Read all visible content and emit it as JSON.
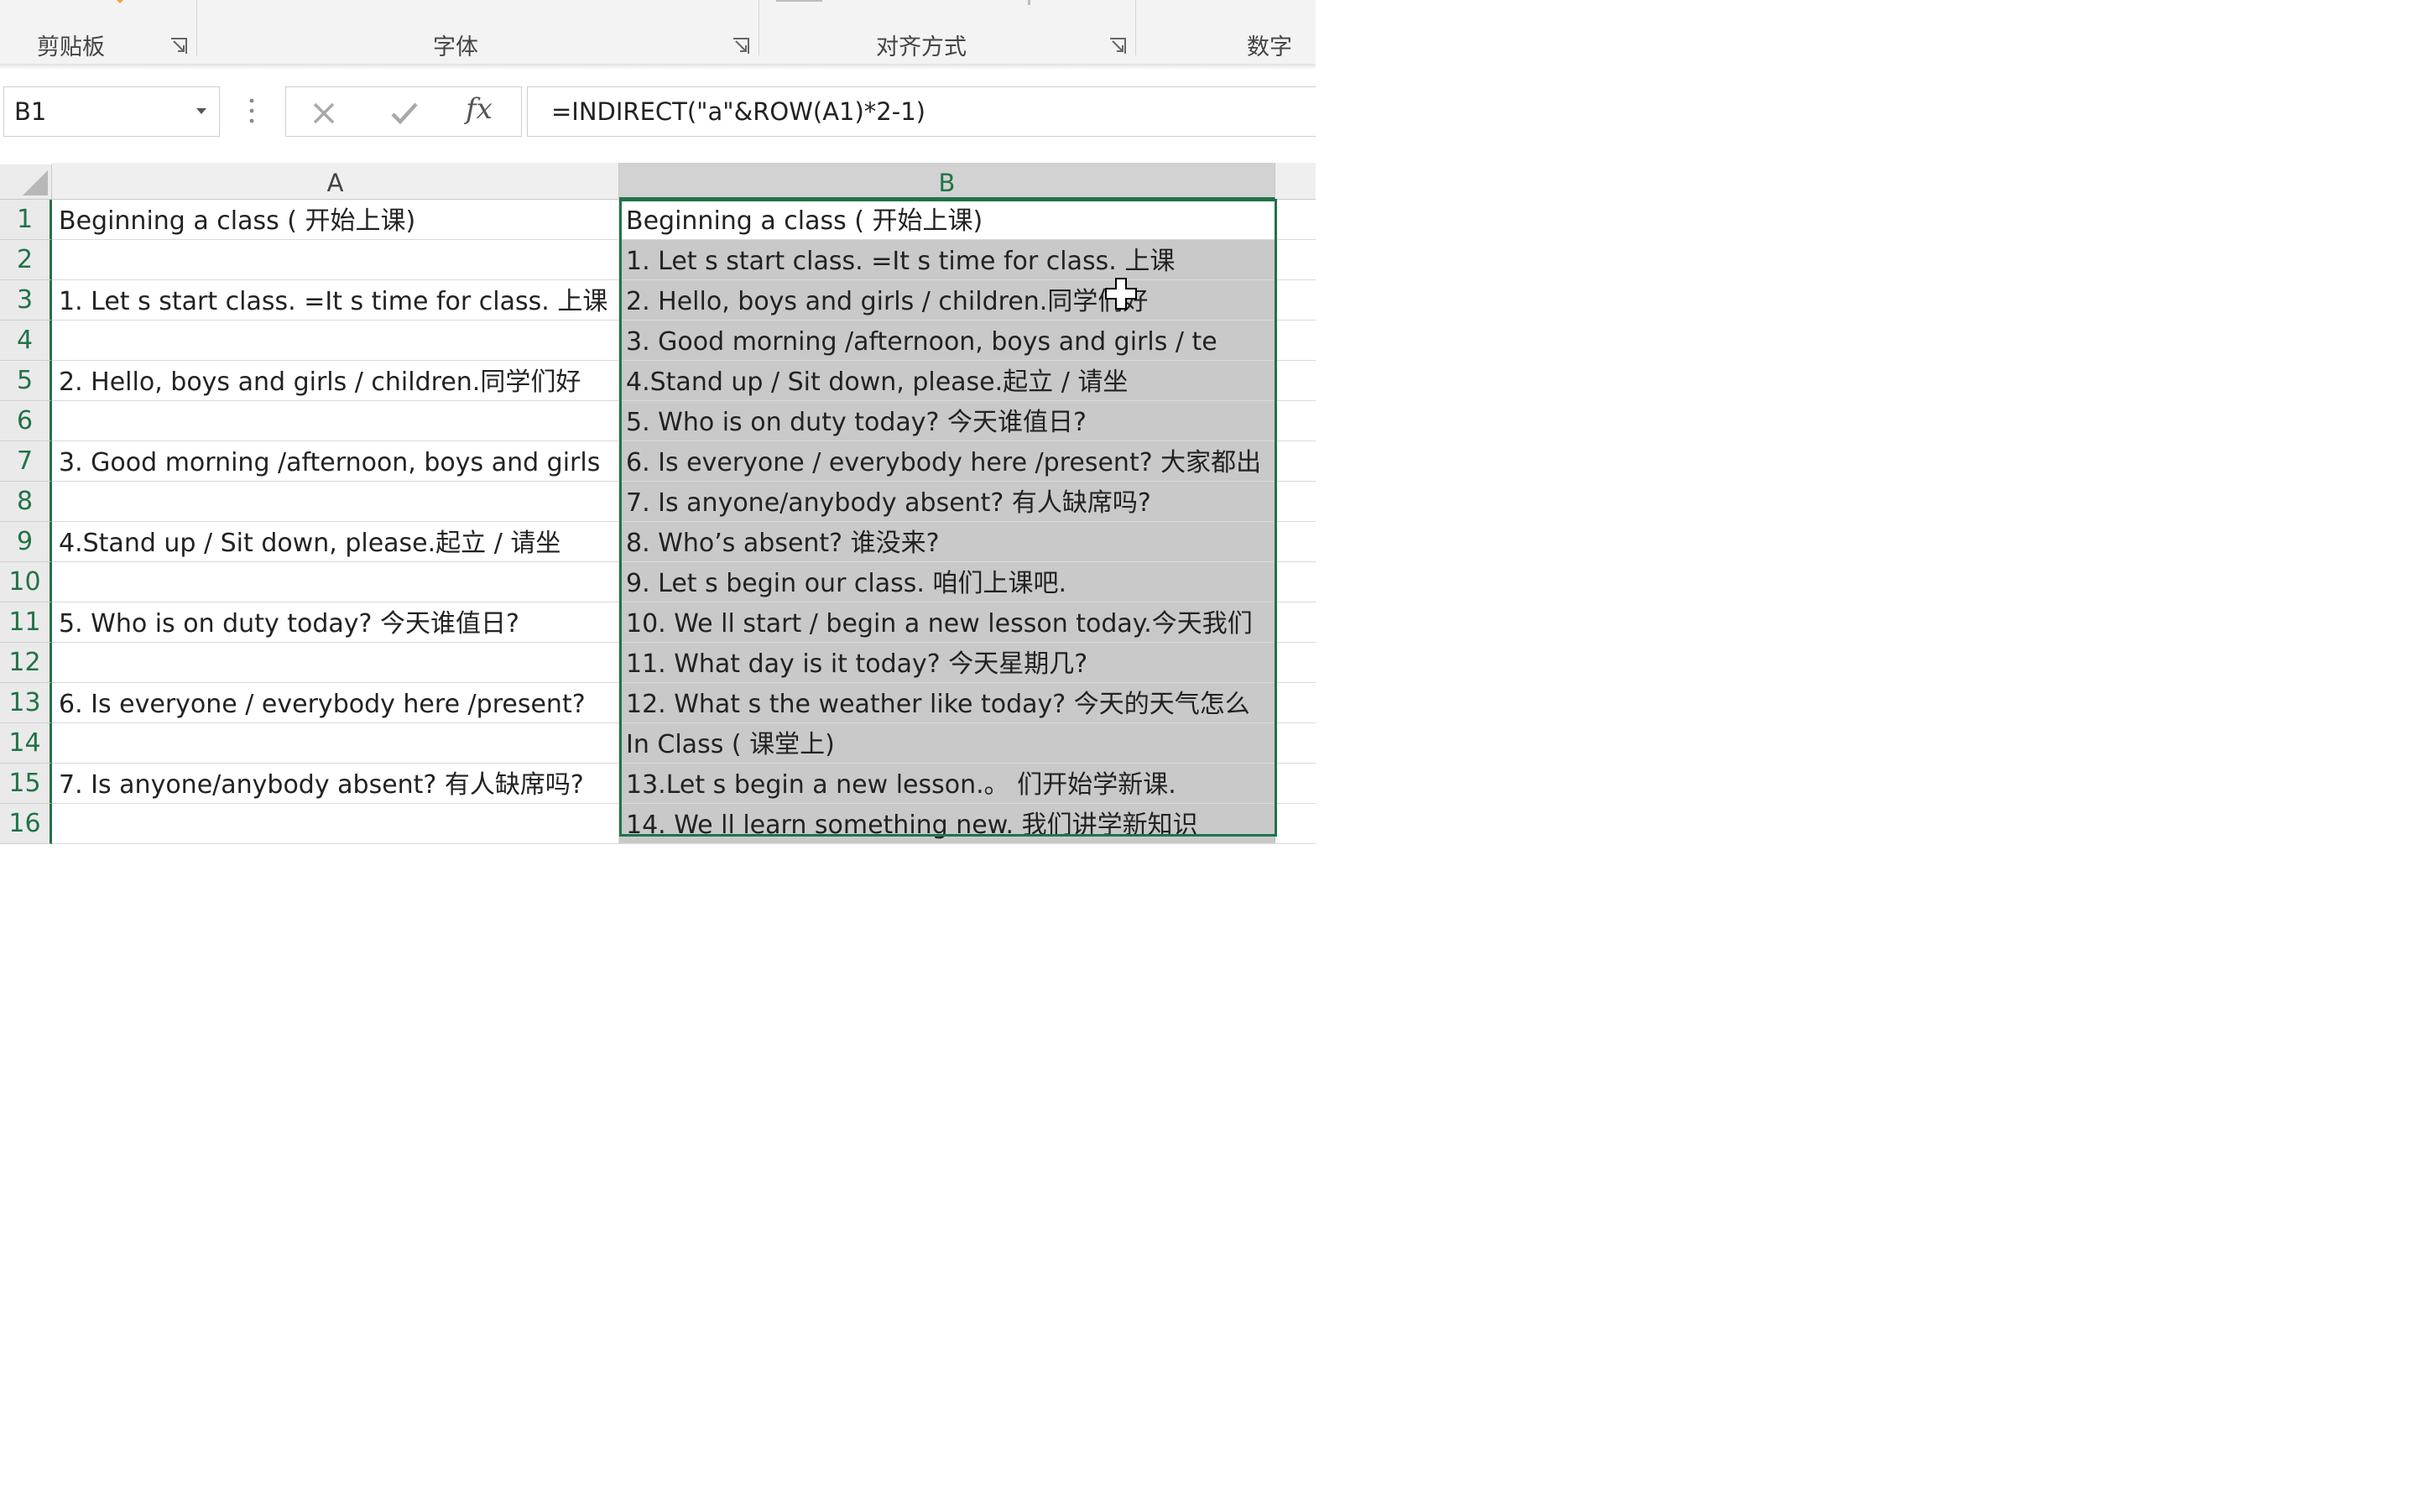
{
  "ribbon": {
    "groups": [
      {
        "label": "剪贴板"
      },
      {
        "label": "字体"
      },
      {
        "label": "对齐方式"
      },
      {
        "label": "数字"
      }
    ]
  },
  "formula_bar": {
    "name_box": "B1",
    "fx_label": "fx",
    "formula": "=INDIRECT(\"a\"&ROW(A1)*2-1)"
  },
  "columns": [
    {
      "label": "A"
    },
    {
      "label": "B"
    }
  ],
  "colors": {
    "accent": "#217346",
    "selection_fill": "#c9c9c9"
  },
  "rows": [
    {
      "num": "1",
      "a": "Beginning a class ( 开始上课)",
      "b": "Beginning a class ( 开始上课)"
    },
    {
      "num": "2",
      "a": "",
      "b": "1. Let s start class. =It s time for class. 上课"
    },
    {
      "num": "3",
      "a": "1. Let s start class. =It s time for class. 上课",
      "b": "2. Hello, boys and girls / children.同学们好"
    },
    {
      "num": "4",
      "a": "",
      "b": "3. Good morning /afternoon, boys and girls / te"
    },
    {
      "num": "5",
      "a": "2. Hello, boys and girls / children.同学们好",
      "b": "4.Stand up / Sit down, please.起立 / 请坐"
    },
    {
      "num": "6",
      "a": "",
      "b": "5. Who is on duty today? 今天谁值日?"
    },
    {
      "num": "7",
      "a": "3. Good morning /afternoon, boys and girls",
      "b": "6. Is everyone / everybody here /present? 大家都出"
    },
    {
      "num": "8",
      "a": "",
      "b": "7. Is anyone/anybody absent? 有人缺席吗?"
    },
    {
      "num": "9",
      "a": "4.Stand up / Sit down, please.起立 / 请坐",
      "b": "8. Who’s absent? 谁没来?"
    },
    {
      "num": "10",
      "a": "",
      "b": "9. Let s begin our class. 咱们上课吧."
    },
    {
      "num": "11",
      "a": "5. Who is on duty today? 今天谁值日?",
      "b": "10. We ll start / begin a new lesson today.今天我们"
    },
    {
      "num": "12",
      "a": "",
      "b": "11. What day is it today? 今天星期几?"
    },
    {
      "num": "13",
      "a": "6. Is everyone / everybody here /present?",
      "b": "12. What s the weather like today? 今天的天气怎么"
    },
    {
      "num": "14",
      "a": "",
      "b": "In Class ( 课堂上)"
    },
    {
      "num": "15",
      "a": "7. Is anyone/anybody absent? 有人缺席吗?",
      "b": "13.Let s begin a new lesson.。 们开始学新课."
    },
    {
      "num": "16",
      "a": "",
      "b": "14. We ll learn something new. 我们讲学新知识"
    }
  ]
}
